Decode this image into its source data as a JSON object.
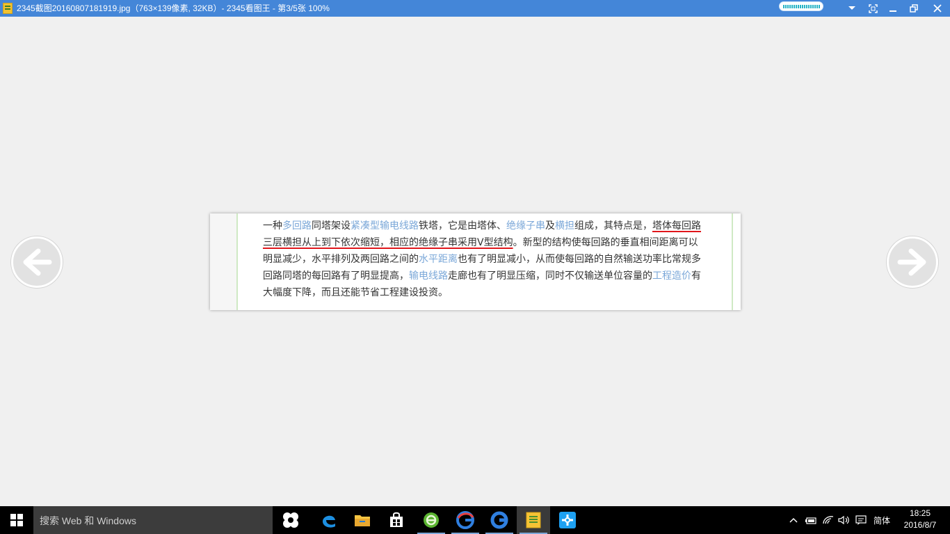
{
  "window": {
    "title": "2345截图20160807181919.jpg（763×139像素, 32KB）- 2345看图王 - 第3/5张 100%"
  },
  "title_controls": [
    "dropdown-icon",
    "fullscreen-icon",
    "minimize-icon",
    "restore-icon",
    "close-icon"
  ],
  "document": {
    "lines": [
      [
        {
          "t": "一种",
          "s": "n"
        },
        {
          "t": "多回路",
          "s": "link"
        },
        {
          "t": "同塔架设",
          "s": "n"
        },
        {
          "t": "紧凑型输电线路",
          "s": "link"
        },
        {
          "t": "铁塔，它是由塔体、",
          "s": "n"
        },
        {
          "t": "绝缘子串",
          "s": "link"
        },
        {
          "t": "及",
          "s": "n"
        },
        {
          "t": "横担",
          "s": "link"
        },
        {
          "t": "组成，其特点是，",
          "s": "n"
        },
        {
          "t": "塔体每回路",
          "s": "ul"
        }
      ],
      [
        {
          "t": "三层横担从上到下依次缩短，相应的绝缘子串采用V型结构",
          "s": "ul"
        },
        {
          "t": "。新型的结构使每回路的垂直相间距离可以",
          "s": "n"
        }
      ],
      [
        {
          "t": "明显减少，水平排列及两回路之间的",
          "s": "n"
        },
        {
          "t": "水平距离",
          "s": "link"
        },
        {
          "t": "也有了明显减小，从而使每回路的自然输送功率比常规多",
          "s": "n"
        }
      ],
      [
        {
          "t": "回路同塔的每回路有了明显提高，",
          "s": "n"
        },
        {
          "t": "输电线路",
          "s": "link"
        },
        {
          "t": "走廊也有了明显压缩，同时不仅输送单位容量的",
          "s": "n"
        },
        {
          "t": "工程造价",
          "s": "link"
        },
        {
          "t": "有",
          "s": "n"
        }
      ],
      [
        {
          "t": "大幅度下降，而且还能节省工程建设投资。",
          "s": "n"
        }
      ]
    ]
  },
  "navigation": {
    "prev_icon": "arrow-left-icon",
    "next_icon": "arrow-right-icon"
  },
  "taskbar": {
    "search_placeholder": "搜索 Web 和 Windows",
    "apps": [
      {
        "name": "task-view-icon",
        "active": false
      },
      {
        "name": "edge-icon",
        "active": false
      },
      {
        "name": "file-explorer-icon",
        "active": false
      },
      {
        "name": "store-icon",
        "active": false
      },
      {
        "name": "browser-green-icon",
        "active": false
      },
      {
        "name": "2345-browser-icon",
        "active": false
      },
      {
        "name": "2345-g-icon",
        "active": false
      },
      {
        "name": "2345-viewer-icon",
        "active": true
      },
      {
        "name": "cross-app-icon",
        "active": false
      }
    ],
    "ime": "简体",
    "time": "18:25",
    "date": "2016/8/7"
  },
  "colors": {
    "titlebar": "#4486d8",
    "link": "#7aa7d8",
    "underline": "#e0161b",
    "background": "#f0f0f0"
  }
}
